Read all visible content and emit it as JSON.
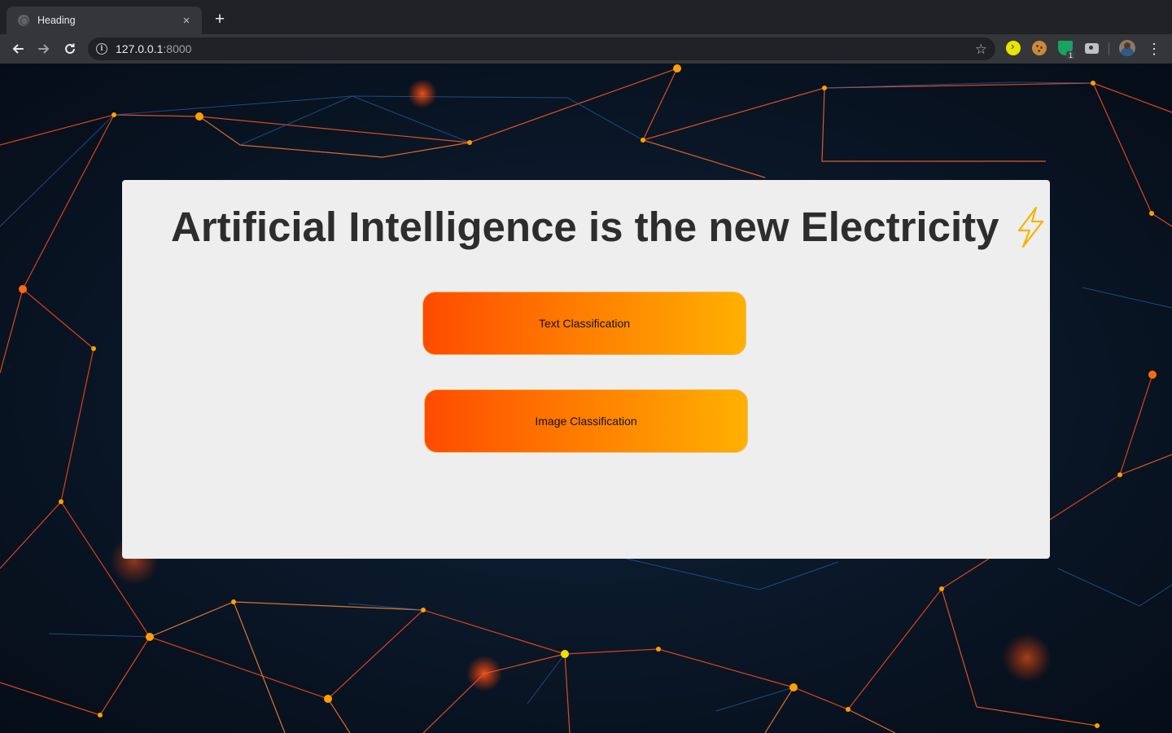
{
  "browser": {
    "tab": {
      "title": "Heading",
      "close_label": "×"
    },
    "new_tab_label": "+",
    "address": {
      "host": "127.0.0.1",
      "port": ":8000"
    },
    "extensions": [
      "forward-ext-icon",
      "cookie-ext-icon",
      "shield-ext-icon",
      "camera-ext-icon"
    ],
    "shield_badge": "1"
  },
  "page": {
    "heading": "Artificial Intelligence is the new Electricity",
    "buttons": {
      "text_classification": "Text Classification",
      "image_classification": "Image Classification"
    }
  },
  "colors": {
    "card_bg": "#eeeeee",
    "button_gradient_start": "#ff4b00",
    "button_gradient_end": "#ffb000",
    "bolt": "#f5b400",
    "background": "#0b1828"
  }
}
